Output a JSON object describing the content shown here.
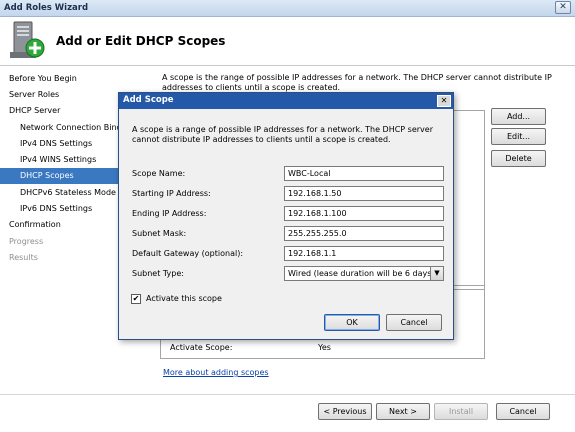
{
  "window": {
    "title": "Add Roles Wizard",
    "close_label": "✕"
  },
  "header": {
    "title": "Add or Edit DHCP Scopes",
    "icon": "server-add-icon"
  },
  "nav": {
    "items": [
      {
        "label": "Before You Begin",
        "state": "normal"
      },
      {
        "label": "Server Roles",
        "state": "normal"
      },
      {
        "label": "DHCP Server",
        "state": "normal"
      },
      {
        "label": "Network Connection Bindings",
        "state": "normal"
      },
      {
        "label": "IPv4 DNS Settings",
        "state": "normal"
      },
      {
        "label": "IPv4 WINS Settings",
        "state": "normal"
      },
      {
        "label": "DHCP Scopes",
        "state": "selected"
      },
      {
        "label": "DHCPv6 Stateless Mode",
        "state": "normal"
      },
      {
        "label": "IPv6 DNS Settings",
        "state": "normal"
      },
      {
        "label": "Confirmation",
        "state": "normal"
      },
      {
        "label": "Progress",
        "state": "disabled"
      },
      {
        "label": "Results",
        "state": "disabled"
      }
    ]
  },
  "main": {
    "description": "A scope is the range of possible IP addresses for a network. The DHCP server cannot distribute IP addresses to clients until a scope is created.",
    "buttons": {
      "add": "Add...",
      "edit": "Edit...",
      "delete": "Delete"
    },
    "properties": {
      "label": "Activate Scope:",
      "value": "Yes"
    },
    "more_link": "More about adding scopes"
  },
  "footer": {
    "previous": "< Previous",
    "next": "Next >",
    "install": "Install",
    "cancel": "Cancel"
  },
  "dialog": {
    "title": "Add Scope",
    "close_label": "✕",
    "description": "A scope is a range of possible IP addresses for a network. The DHCP server cannot distribute IP addresses to clients until a scope is created.",
    "fields": {
      "scope_name": {
        "label": "Scope Name:",
        "value": "WBC-Local"
      },
      "starting_ip": {
        "label": "Starting IP Address:",
        "value": "192.168.1.50"
      },
      "ending_ip": {
        "label": "Ending IP Address:",
        "value": "192.168.1.100"
      },
      "subnet_mask": {
        "label": "Subnet Mask:",
        "value": "255.255.255.0"
      },
      "default_gateway": {
        "label": "Default Gateway (optional):",
        "value": "192.168.1.1"
      },
      "subnet_type": {
        "label": "Subnet Type:",
        "value": "Wired (lease duration will be 6 days)"
      }
    },
    "activate": {
      "label": "Activate this scope",
      "checked": true,
      "mark": "✔"
    },
    "ok": "OK",
    "cancel": "Cancel"
  },
  "colors": {
    "selection": "#3a78c2",
    "dialog_title": "#2458a8",
    "link": "#0a3ea8"
  }
}
